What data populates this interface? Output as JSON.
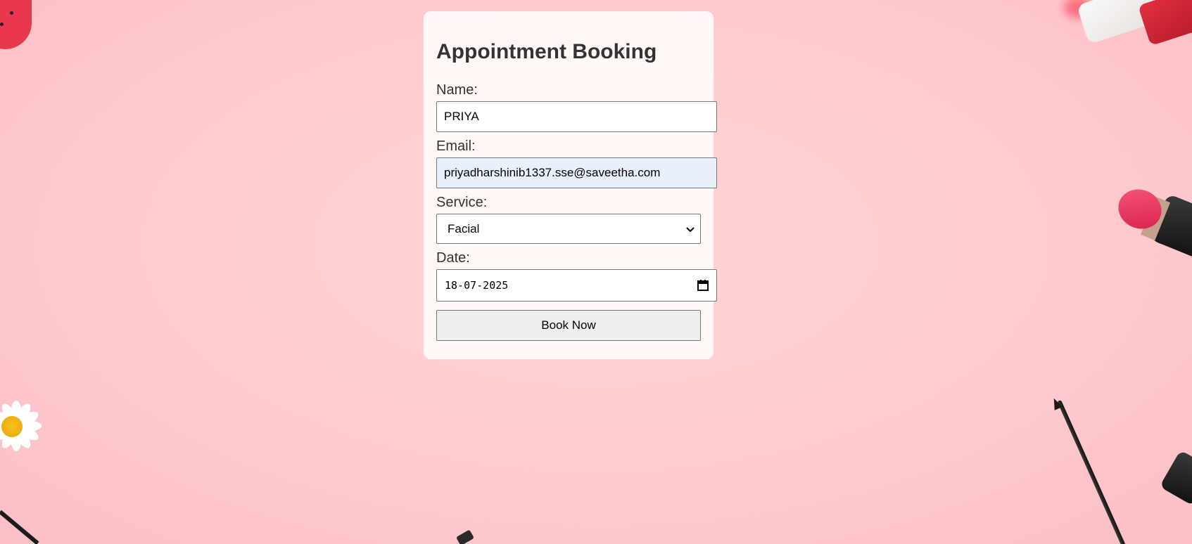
{
  "page": {
    "background_color": "#ffcdd1"
  },
  "form": {
    "title": "Appointment Booking",
    "name_label": "Name:",
    "name_value": "PRIYA",
    "email_label": "Email:",
    "email_value": "priyadharshinib1337.sse@saveetha.com",
    "service_label": "Service:",
    "service_selected": "Facial",
    "date_label": "Date:",
    "date_value": "18-07-2025",
    "submit_label": "Book Now"
  },
  "icons": {
    "service_dropdown": "chevron-down-icon",
    "date_picker": "calendar-icon"
  },
  "colors": {
    "card_bg": "#fffbfa",
    "autofill_bg": "#e8f0fe",
    "button_bg": "#efefef",
    "text": "#333333"
  }
}
